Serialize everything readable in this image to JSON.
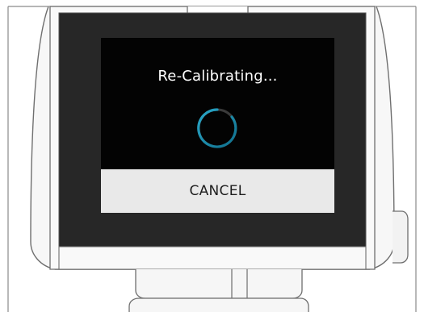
{
  "dialog": {
    "title": "Re-Calibrating...",
    "spinner_icon": "loading-spinner-icon",
    "cancel_label": "CANCEL"
  },
  "colors": {
    "screen_background": "#272727",
    "dialog_background": "#030303",
    "button_background": "#e9e9e9",
    "spinner_accent": "#1b8fb0",
    "spinner_track": "#3a3a3a",
    "device_outline": "#707070",
    "device_fill": "#f5f5f5"
  }
}
